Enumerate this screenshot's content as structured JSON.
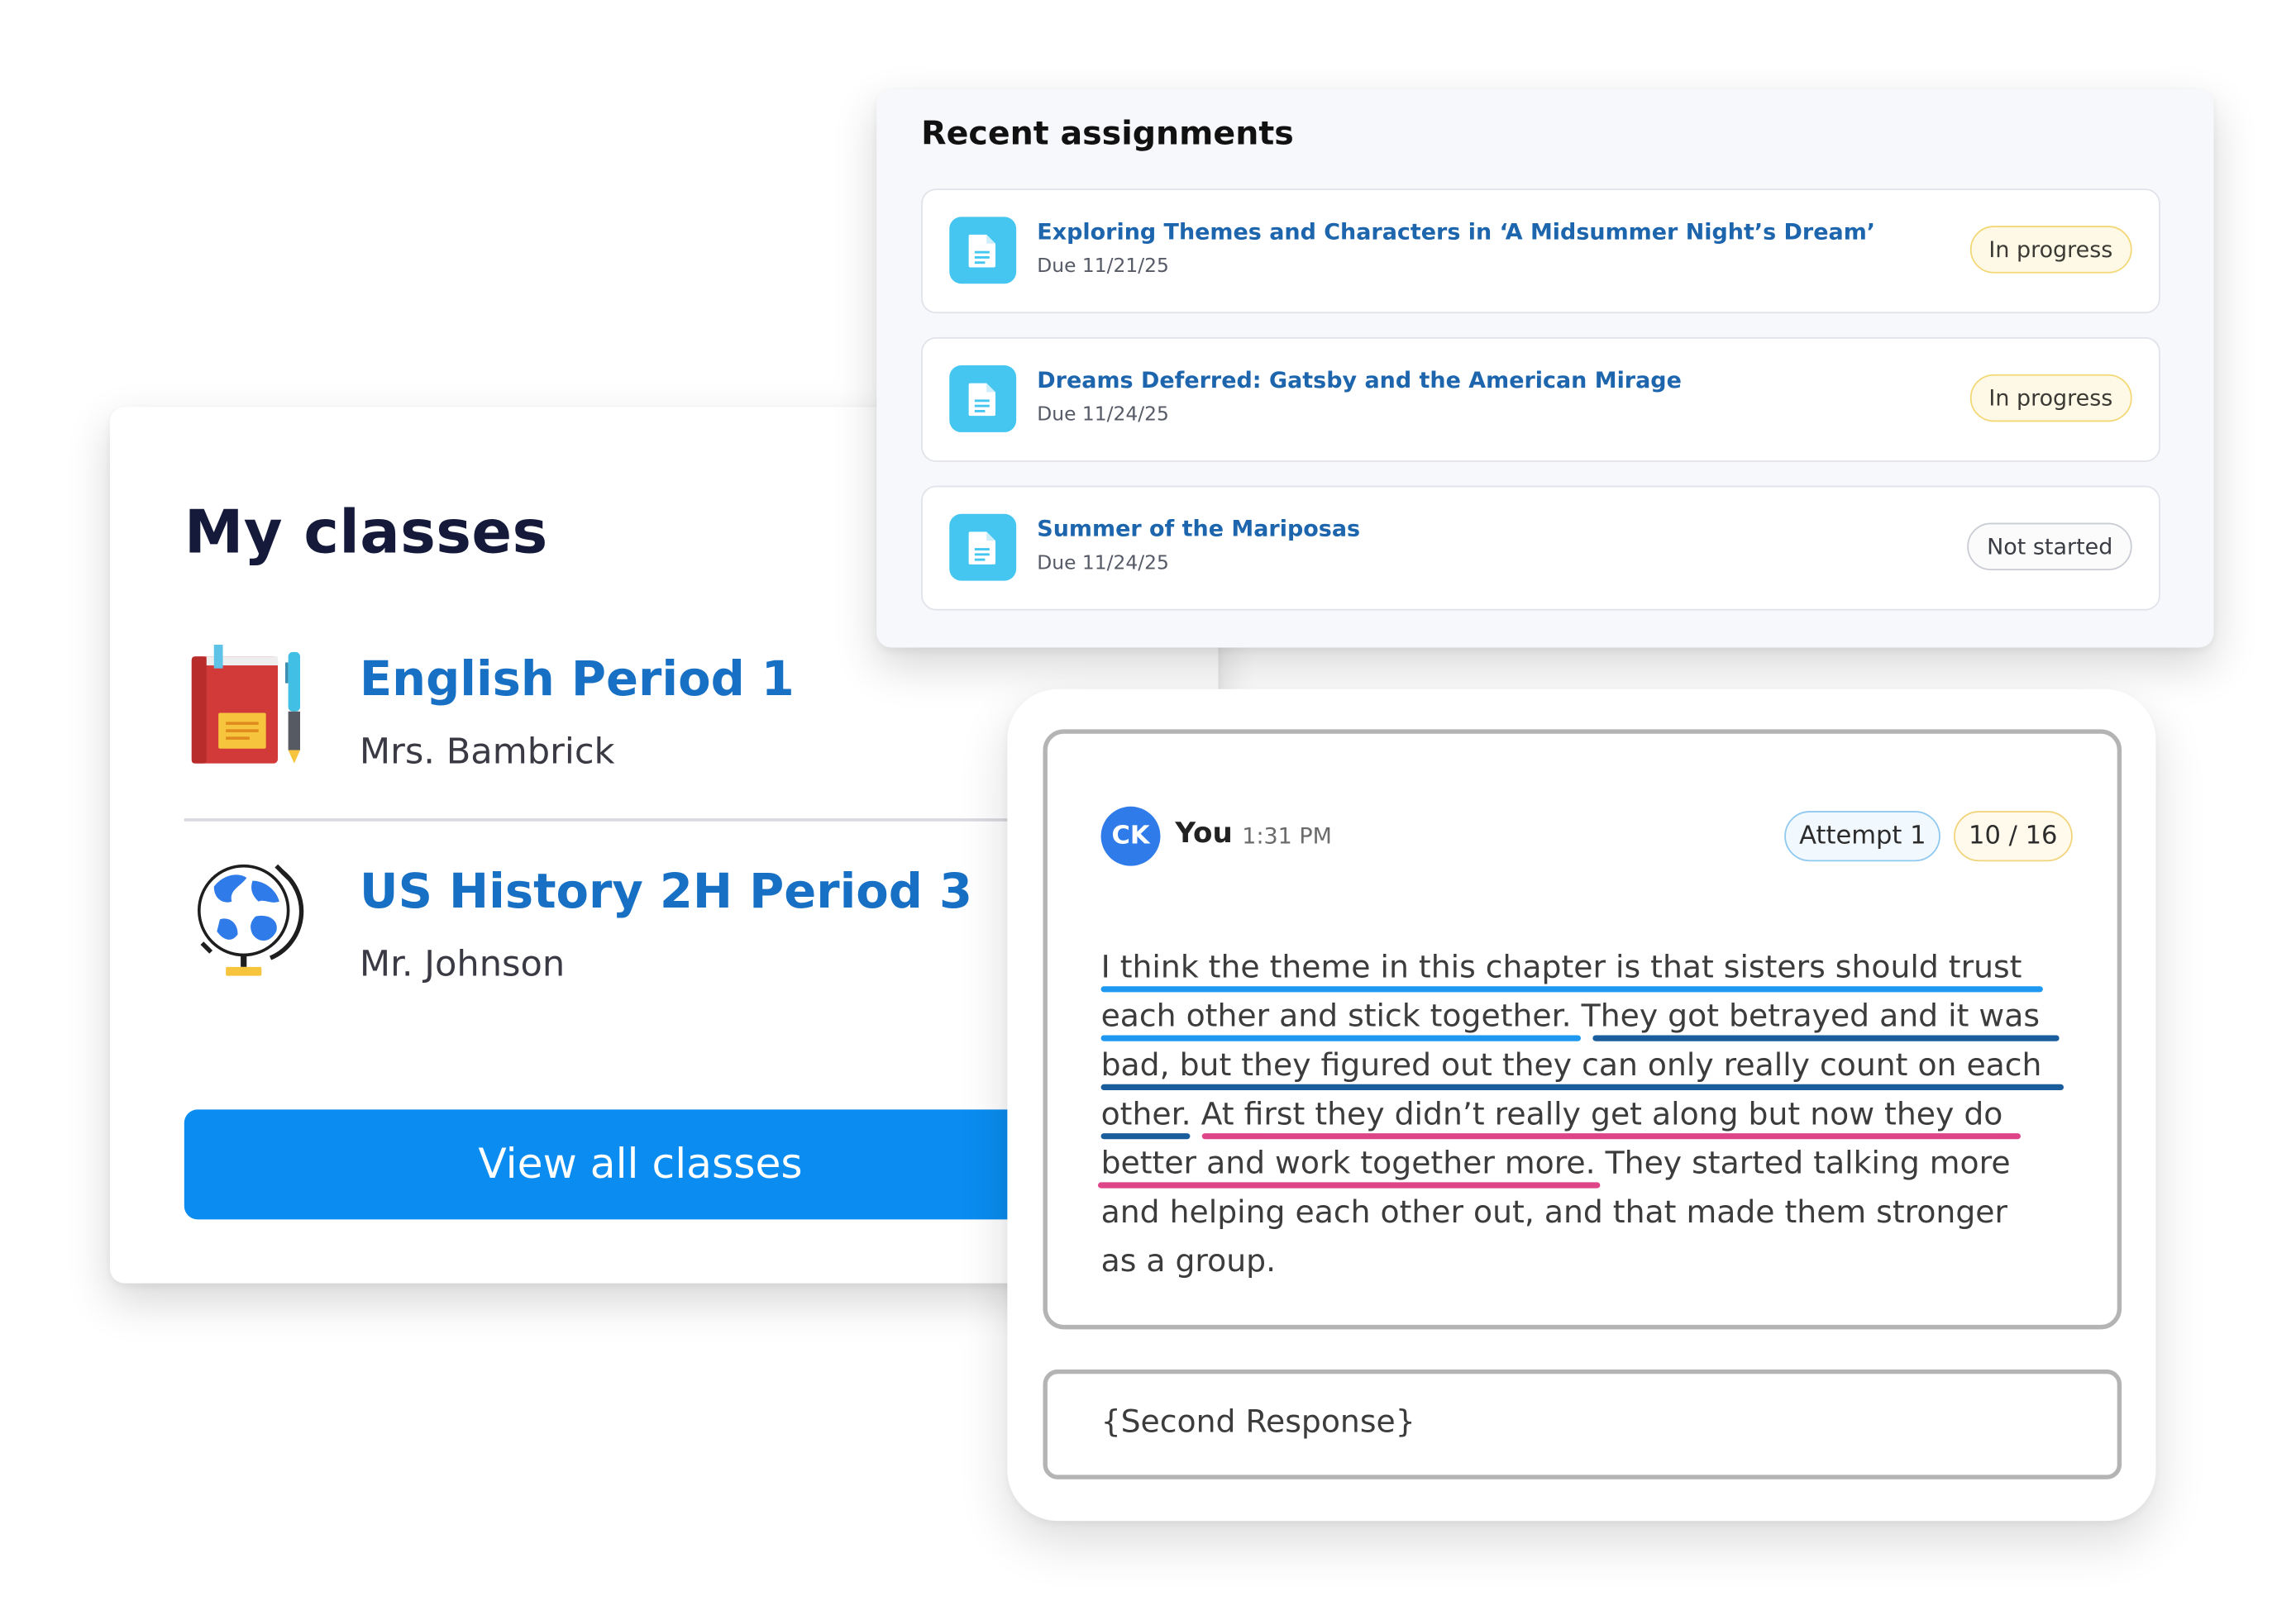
{
  "classes": {
    "title": "My classes",
    "items": [
      {
        "name": "English Period 1",
        "teacher": "Mrs. Bambrick",
        "icon": "book-pen-icon"
      },
      {
        "name": "US History 2H Period 3",
        "teacher": "Mr. Johnson",
        "icon": "globe-icon"
      }
    ],
    "view_all_label": "View all classes"
  },
  "assignments": {
    "title": "Recent assignments",
    "items": [
      {
        "name": "Exploring Themes and Characters in ‘A Midsummer Night’s Dream’",
        "due": "Due 11/21/25",
        "status": "In progress"
      },
      {
        "name": "Dreams Deferred: Gatsby and the American Mirage",
        "due": "Due 11/24/25",
        "status": "In progress"
      },
      {
        "name": "Summer of the Mariposas",
        "due": "Due 11/24/25",
        "status": "Not started"
      }
    ]
  },
  "response": {
    "avatar_initials": "CK",
    "author": "You",
    "time": "1:31 PM",
    "attempt": "Attempt 1",
    "score": "10 / 16",
    "lines": [
      "I think the theme in this chapter is that sisters should trust",
      "each other and stick together. They got betrayed and it was",
      "bad, but they figured out they can only really count on each",
      "other. At first they didn’t really get along but now they do",
      "better and work together more. They started talking more",
      "and helping each other out, and that made them stronger",
      "as a group."
    ],
    "second_response": "{Second Response}"
  },
  "colors": {
    "primary_button": "#0a8cf0",
    "class_link": "#1770c4",
    "assignment_link": "#1d66ad",
    "doc_tile": "#44c6f0",
    "underline_blue": "#1e98f0",
    "underline_navy": "#1a5d9c",
    "underline_pink": "#de4488"
  }
}
